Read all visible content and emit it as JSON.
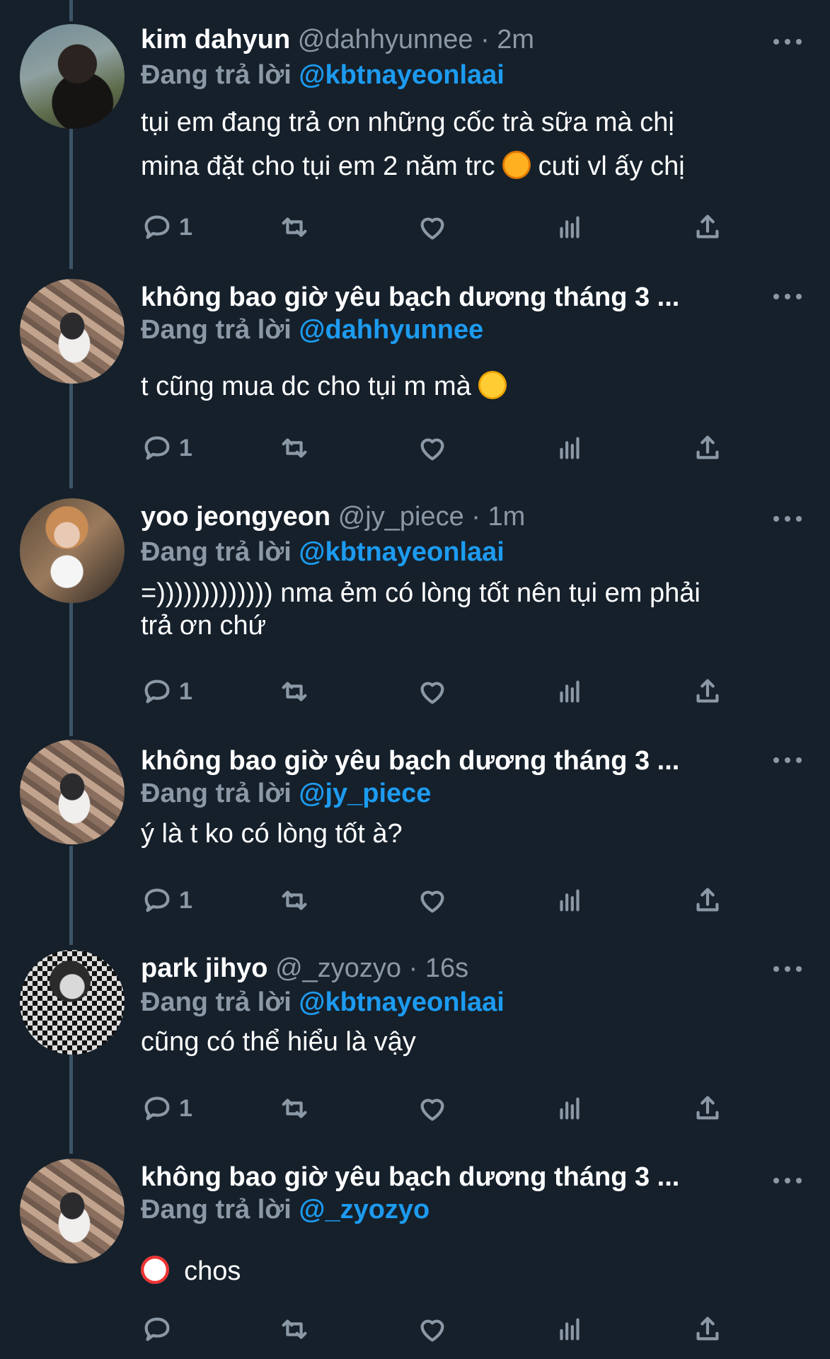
{
  "tweets": [
    {
      "name": "kim dahyun",
      "handle": "@dahhyunnee",
      "separator": "·",
      "time": "2m",
      "reply_prefix": "Đang trả lời",
      "reply_to": "@kbtnayeonlaai",
      "text_line1": "tụi em đang trả ơn những cốc trà sữa mà chị",
      "text_line2a": "mina đặt cho tụi em 2 năm trc",
      "text_line2b": " cuti vl ấy chị",
      "reply_count": "1"
    },
    {
      "name": "không bao giờ yêu bạch dương tháng 3 ...",
      "reply_prefix": "Đang trả lời",
      "reply_to": "@dahhyunnee",
      "text": "t cũng mua dc cho tụi m mà",
      "reply_count": "1"
    },
    {
      "name": "yoo jeongyeon",
      "handle": "@jy_piece",
      "separator": "·",
      "time": "1m",
      "reply_prefix": "Đang trả lời",
      "reply_to": "@kbtnayeonlaai",
      "text_line1": "=))))))))))))) nma ẻm có lòng tốt nên tụi em phải",
      "text_line2": "trả ơn chứ",
      "reply_count": "1"
    },
    {
      "name": "không bao giờ yêu bạch dương tháng 3 ...",
      "reply_prefix": "Đang trả lời",
      "reply_to": "@jy_piece",
      "text": "ý là t ko có lòng tốt à?",
      "reply_count": "1"
    },
    {
      "name": "park jihyo",
      "handle": "@_zyozyo",
      "separator": "·",
      "time": "16s",
      "reply_prefix": "Đang trả lời",
      "reply_to": "@kbtnayeonlaai",
      "text": "cũng có thể hiểu là vậy",
      "reply_count": "1"
    },
    {
      "name": "không bao giờ yêu bạch dương tháng 3 ...",
      "reply_prefix": "Đang trả lời",
      "reply_to": "@_zyozyo",
      "text": "chos",
      "reply_count": ""
    }
  ],
  "icons": [
    "reply-icon",
    "retweet-icon",
    "like-icon",
    "views-icon",
    "share-icon",
    "more-icon"
  ]
}
